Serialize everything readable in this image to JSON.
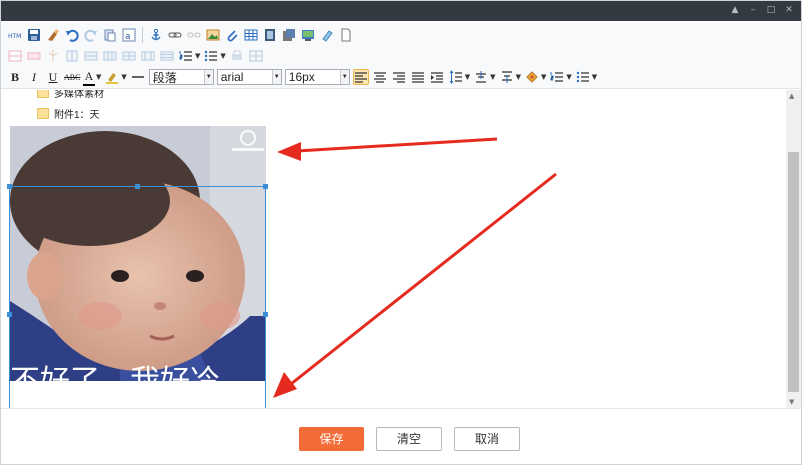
{
  "window": {
    "controls": [
      "▲",
      "–",
      "□",
      "✕"
    ]
  },
  "toolbar": {
    "row1": [
      "html-source-icon",
      "save-icon",
      "clear-format-icon",
      "undo-icon",
      "redo-icon",
      "paste-plain-icon",
      "paste-word-icon",
      "anchor-icon",
      "link-icon",
      "unlink-icon",
      "image-icon",
      "attachment-icon",
      "table-icon",
      "video-icon",
      "music-icon",
      "gallery-icon",
      "eraser-icon",
      "new-doc-icon"
    ],
    "row2": [
      "insert-row-icon",
      "delete-row-icon",
      "insert-col-icon",
      "delete-col-icon",
      "merge-cells-icon",
      "split-cell-icon",
      "cell-props-icon",
      "table-props-icon",
      "table-delete-icon",
      "ordered-list-icon",
      "unordered-list-icon",
      "print-icon",
      "preview-icon"
    ],
    "bold": "B",
    "italic": "I",
    "underline": "U",
    "strike": "ABC",
    "font_color": "A",
    "paragraph_select": "段落",
    "font_select": "arial",
    "size_select": "16px"
  },
  "content": {
    "files": [
      {
        "label": "多媒体素材"
      },
      {
        "label": "附件1：天"
      }
    ],
    "image_caption_overlay": "不好了，我好冷"
  },
  "footer": {
    "save_label": "保存",
    "clear_label": "清空",
    "cancel_label": "取消"
  },
  "colors": {
    "titlebar": "#333a42",
    "primary": "#f36b36",
    "selection": "#3b8fd6",
    "annotation_arrow": "#e52b20"
  }
}
